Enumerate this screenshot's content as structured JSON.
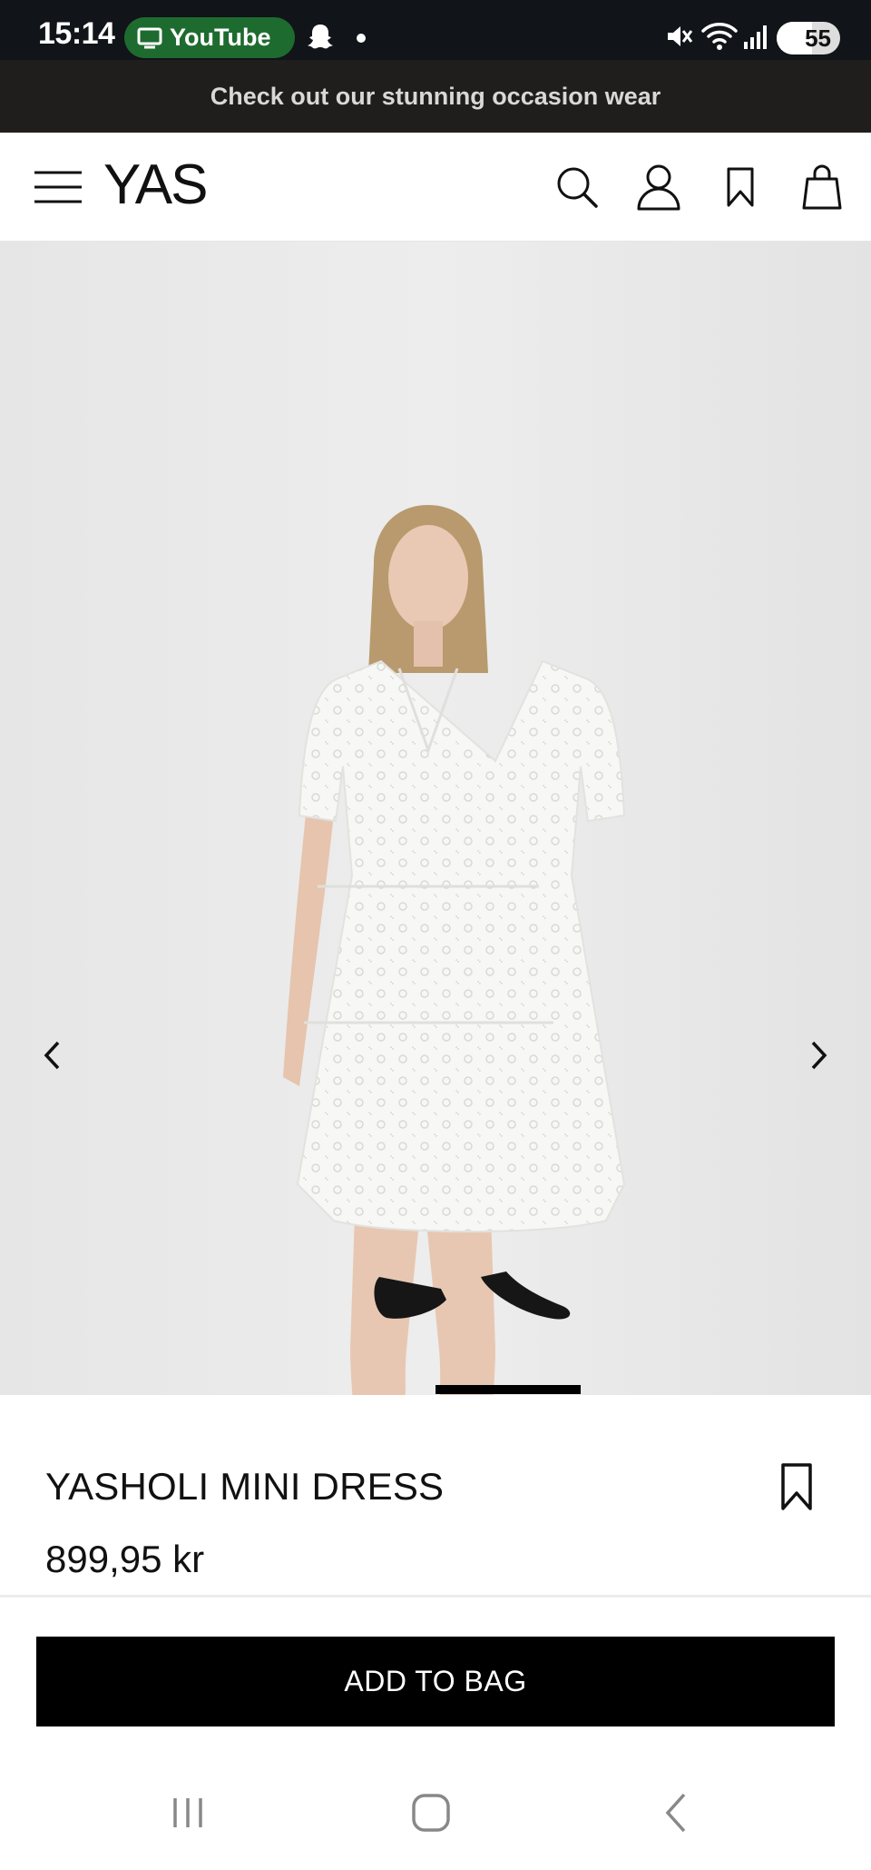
{
  "status_bar": {
    "time": "15:14",
    "app_pill": "YouTube",
    "battery_level": "55",
    "battery_fraction": 0.55,
    "icons": [
      "tv-icon",
      "snapchat-icon",
      "mute-icon",
      "wifi-icon",
      "signal-icon",
      "battery-icon"
    ]
  },
  "promo": {
    "text": "Check out our stunning occasion wear"
  },
  "header": {
    "logo": "YAS",
    "icons": [
      "menu-icon",
      "search-icon",
      "account-icon",
      "wishlist-icon",
      "bag-icon"
    ]
  },
  "gallery": {
    "icons": [
      "chevron-left-icon",
      "chevron-right-icon"
    ],
    "background_color": "#e9e9e9"
  },
  "product": {
    "name": "YASHOLI MINI DRESS",
    "price": "899,95 kr"
  },
  "actions": {
    "add_to_bag": "ADD TO BAG"
  },
  "navbar": {
    "icons": [
      "recent-apps-icon",
      "home-icon",
      "back-icon"
    ]
  },
  "colors": {
    "status_bar": "#111419",
    "promo_bar": "#1f1e1c",
    "pill_green": "#1e6b2f",
    "button": "#000000"
  }
}
